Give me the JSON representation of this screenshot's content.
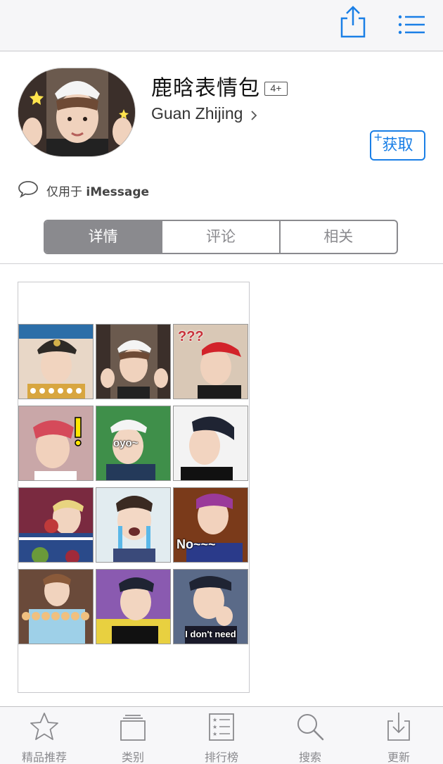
{
  "header": {
    "share_icon": "share-icon",
    "list_icon": "list-icon",
    "accent_color": "#1a7fe6"
  },
  "app": {
    "name": "鹿晗表情包",
    "age_rating": "4+",
    "developer": "Guan Zhijing",
    "get_label": "获取",
    "get_plus": "+",
    "compat_prefix": "仅用于",
    "compat_platform": "iMessage"
  },
  "segments": [
    {
      "label": "详情",
      "active": true
    },
    {
      "label": "评论",
      "active": false
    },
    {
      "label": "相关",
      "active": false
    }
  ],
  "stickers": {
    "texts": [
      "No~~~",
      "I don't need",
      "oyo~",
      "???"
    ]
  },
  "tabbar": {
    "items": [
      {
        "label": "精品推荐",
        "icon": "star-icon"
      },
      {
        "label": "类别",
        "icon": "stack-icon"
      },
      {
        "label": "排行榜",
        "icon": "ranking-list-icon"
      },
      {
        "label": "搜索",
        "icon": "search-icon"
      },
      {
        "label": "更新",
        "icon": "download-icon"
      }
    ]
  }
}
